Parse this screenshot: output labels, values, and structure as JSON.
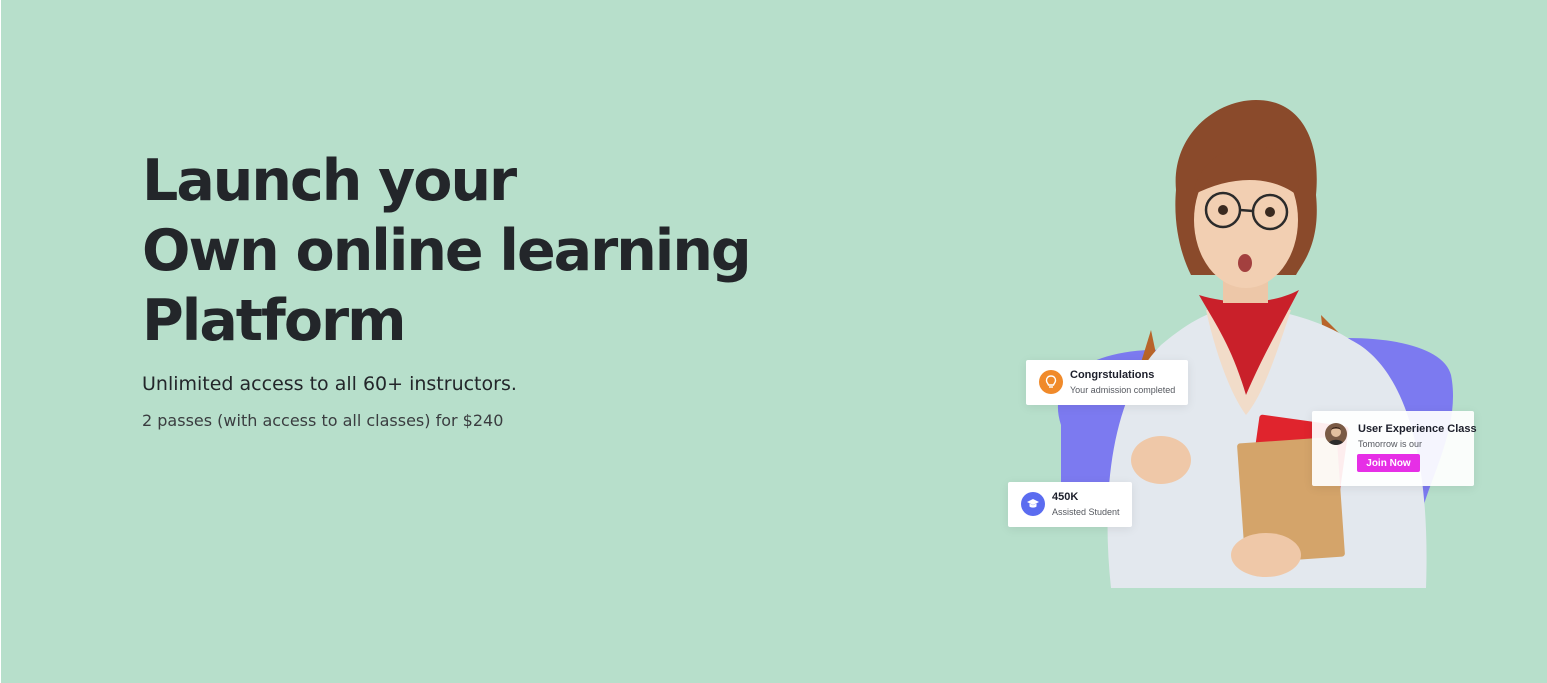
{
  "hero": {
    "headline": [
      "Launch your",
      "Own online learning",
      "Platform"
    ],
    "subtitle": "Unlimited access to all 60+ instructors.",
    "pricing": "2 passes (with access to all classes) for $240"
  },
  "cards": {
    "congrats": {
      "title": "Congrstulations",
      "subtitle": "Your admission completed",
      "icon": "lightbulb-icon",
      "icon_color": "#f08a2a"
    },
    "students": {
      "title": "450K",
      "subtitle": "Assisted Student",
      "icon": "graduation-cap-icon",
      "icon_color": "#5b6cf0"
    },
    "class": {
      "title": "User Experience Class",
      "subtitle": "Tomorrow is our",
      "button_label": "Join Now",
      "button_color": "#e62fe6"
    }
  },
  "colors": {
    "background": "#b7dfcb",
    "text_dark": "#23262a",
    "blob": "#7c7af0"
  }
}
